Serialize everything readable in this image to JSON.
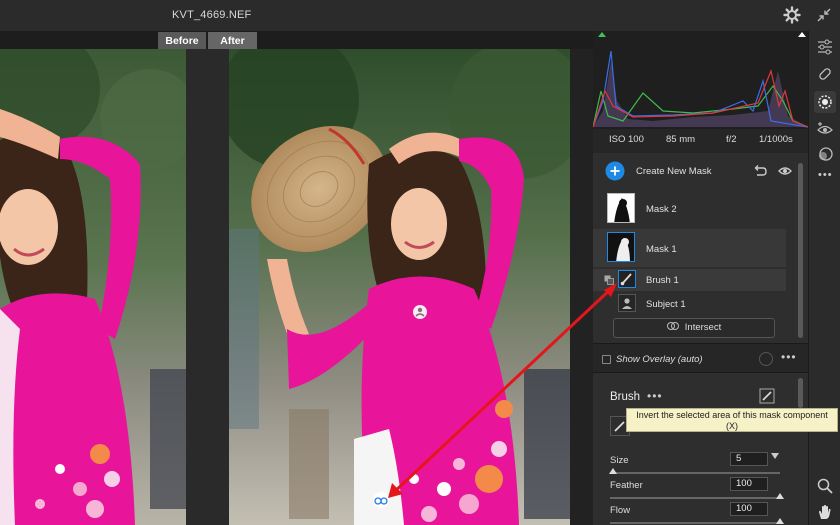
{
  "window": {
    "title": "KVT_4669.NEF"
  },
  "view": {
    "before_label": "Before",
    "after_label": "After"
  },
  "exif": {
    "iso": "ISO 100",
    "focal": "85 mm",
    "aperture": "f/2",
    "shutter": "1/1000s"
  },
  "masks": {
    "create_label": "Create New Mask",
    "items": [
      {
        "label": "Mask 2"
      },
      {
        "label": "Mask 1"
      }
    ],
    "components": [
      {
        "label": "Brush 1"
      },
      {
        "label": "Subject 1"
      }
    ],
    "intersect_label": "Intersect"
  },
  "overlay": {
    "label": "Show Overlay (auto)"
  },
  "brush": {
    "title": "Brush",
    "size": {
      "label": "Size",
      "value": "5",
      "fraction": 0.02
    },
    "feather": {
      "label": "Feather",
      "value": "100",
      "fraction": 1.0
    },
    "flow": {
      "label": "Flow",
      "value": "100",
      "fraction": 1.0
    }
  },
  "tooltip": {
    "line1": "Invert the selected area of this mask component",
    "line2": "(X)"
  },
  "colors": {
    "accent": "#1e8ae6",
    "annotation": "#e5161b",
    "tooltip_bg": "#f6f1c7",
    "dress": "#e8159a"
  }
}
